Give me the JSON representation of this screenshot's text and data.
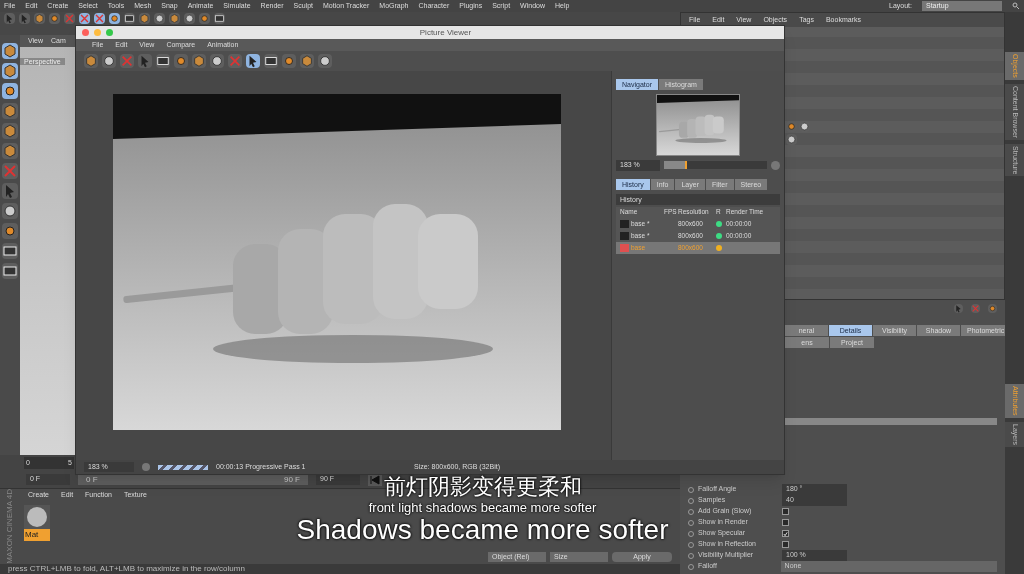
{
  "menu_bar": [
    "File",
    "Edit",
    "Create",
    "Select",
    "Tools",
    "Mesh",
    "Snap",
    "Animate",
    "Simulate",
    "Render",
    "Sculpt",
    "Motion Tracker",
    "MoGraph",
    "Character",
    "Plugins",
    "Script",
    "Window",
    "Help"
  ],
  "layout": {
    "label": "Layout:",
    "value": "Startup"
  },
  "viewport": {
    "menu": [
      "View",
      "Cam"
    ],
    "camera": "Perspective"
  },
  "timeline": {
    "ticks": [
      "0",
      "5"
    ],
    "start_field": "0 F",
    "slider_start": "0 F",
    "slider_end": "90 F",
    "end_field": "90 F"
  },
  "material_manager": {
    "menu": [
      "Create",
      "Edit",
      "Function",
      "Texture"
    ],
    "materials": [
      {
        "name": "Mat",
        "selected": true
      }
    ]
  },
  "coordinates": {
    "mode": "Object (Rel)",
    "size": "Size",
    "apply": "Apply"
  },
  "status_bar": "press CTRL+LMB to fold, ALT+LMB to maximize in the row/column",
  "brand": "MAXON CINEMA 4D",
  "picture_viewer": {
    "title": "Picture Viewer",
    "menu": [
      "File",
      "Edit",
      "View",
      "Compare",
      "Animation"
    ],
    "navigator_tabs": [
      {
        "label": "Navigator",
        "selected": true
      },
      {
        "label": "Histogram",
        "selected": false
      }
    ],
    "zoom": "183 %",
    "zoom_slider": {
      "level": 0.22
    },
    "info_tabs": [
      {
        "label": "History",
        "selected": true
      },
      {
        "label": "Info",
        "selected": false
      },
      {
        "label": "Layer",
        "selected": false
      },
      {
        "label": "Filter",
        "selected": false
      },
      {
        "label": "Stereo",
        "selected": false
      }
    ],
    "history_title": "History",
    "history_columns": [
      "Name",
      "FPS",
      "Resolution",
      "R",
      "Render Time"
    ],
    "history_rows": [
      {
        "name": "base *",
        "resolution": "800x600",
        "color": "#3ddc84",
        "render_time": "00:00:00",
        "selected": false
      },
      {
        "name": "base *",
        "resolution": "800x600",
        "color": "#3ddc84",
        "render_time": "00:00:00",
        "selected": false
      },
      {
        "name": "base",
        "resolution": "800x600",
        "color": "#f0b020",
        "selected": true
      }
    ],
    "status": {
      "zoom": "183 %",
      "progress": "00:00:13 Progressive Pass 1",
      "size": "Size: 800x600, RGB (32Bit)"
    }
  },
  "object_manager": {
    "menu": [
      "File",
      "Edit",
      "View",
      "Objects",
      "Tags",
      "Bookmarks"
    ]
  },
  "side_tabs": [
    {
      "label": "Objects",
      "selected": true
    },
    {
      "label": "Content Browser",
      "selected": false
    },
    {
      "label": "Structure",
      "selected": false
    }
  ],
  "side_tabs_lower": [
    {
      "label": "Attributes",
      "selected": true
    },
    {
      "label": "Layers",
      "selected": false
    }
  ],
  "attributes": {
    "tabs": [
      {
        "label": "neral",
        "selected": false
      },
      {
        "label": "Details",
        "selected": true
      },
      {
        "label": "Visibility",
        "selected": false
      },
      {
        "label": "Shadow",
        "selected": false
      },
      {
        "label": "Photometric",
        "selected": false
      }
    ],
    "tabs_row2": [
      {
        "label": "ens",
        "selected": false
      },
      {
        "label": "Project",
        "selected": false
      }
    ],
    "properties": [
      {
        "kind": "value",
        "label": "Falloff Angle",
        "value": "180 °"
      },
      {
        "kind": "value",
        "label": "Samples",
        "value": "40"
      },
      {
        "kind": "checkbox",
        "label": "Add Grain (Slow)",
        "checked": false
      },
      {
        "kind": "checkbox",
        "label": "Show in Render",
        "checked": false
      },
      {
        "kind": "checkbox",
        "label": "Show Specular",
        "checked": true
      },
      {
        "kind": "checkbox",
        "label": "Show in Reflection",
        "checked": false
      },
      {
        "kind": "value",
        "label": "Visibility Multiplier",
        "value": "100 %"
      },
      {
        "kind": "dropdown",
        "label": "Falloff",
        "value": "None"
      }
    ]
  },
  "subtitles": [
    "前灯阴影变得更柔和",
    "front light shadows became more softer",
    "Shadows became more softer"
  ]
}
